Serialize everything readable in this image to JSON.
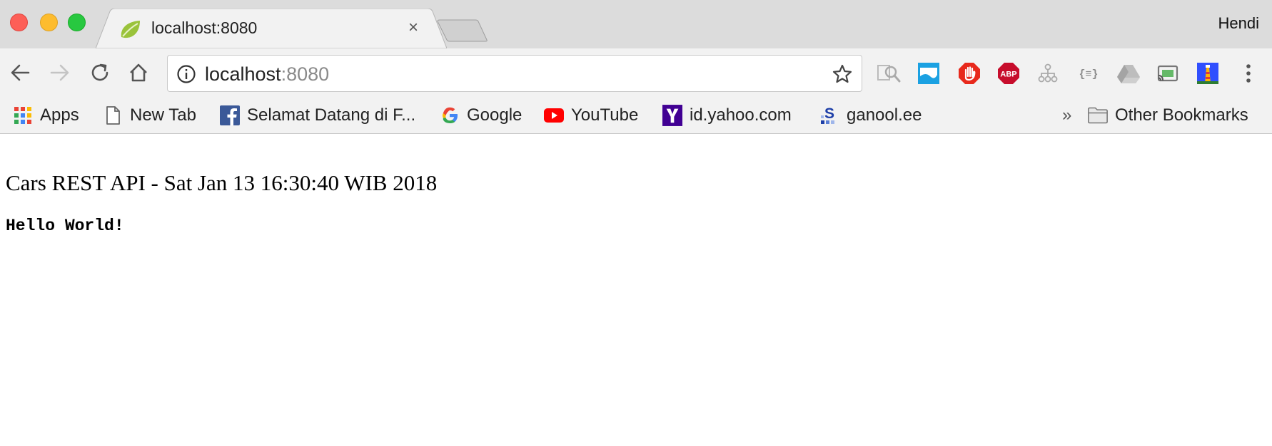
{
  "window": {
    "profile_name": "Hendi"
  },
  "tab": {
    "title": "localhost:8080",
    "close_glyph": "×"
  },
  "omnibox": {
    "host": "localhost",
    "port": ":8080"
  },
  "extensions": [
    "magnifier-icon",
    "window-resizer-icon",
    "adblock-hand-icon",
    "adblock-plus-icon",
    "sitemap-icon",
    "json-formatter-icon",
    "google-drive-icon",
    "cast-icon",
    "lighthouse-icon",
    "menu-dots-icon"
  ],
  "bookmarks": {
    "items": [
      {
        "label": "Apps",
        "icon": "apps-grid-icon"
      },
      {
        "label": "New Tab",
        "icon": "page-icon"
      },
      {
        "label": "Selamat Datang di F...",
        "icon": "facebook-icon"
      },
      {
        "label": "Google",
        "icon": "google-icon"
      },
      {
        "label": "YouTube",
        "icon": "youtube-icon"
      },
      {
        "label": "id.yahoo.com",
        "icon": "yahoo-icon"
      },
      {
        "label": "ganool.ee",
        "icon": "ganool-icon"
      }
    ],
    "overflow_glyph": "»",
    "other": {
      "label": "Other Bookmarks",
      "icon": "folder-icon"
    }
  },
  "page": {
    "heading": "Cars REST API - Sat Jan 13 16:30:40 WIB 2018",
    "body": "Hello World!"
  },
  "colors": {
    "tabstrip_bg": "#dcdcdc",
    "toolbar_bg": "#f2f2f2",
    "traffic_close": "#fd5f57",
    "traffic_min": "#fdbc2e",
    "traffic_max": "#28c840",
    "facebook": "#3b5998",
    "youtube": "#ff0000",
    "yahoo": "#410093",
    "adblock_plus": "#c70d2c"
  }
}
